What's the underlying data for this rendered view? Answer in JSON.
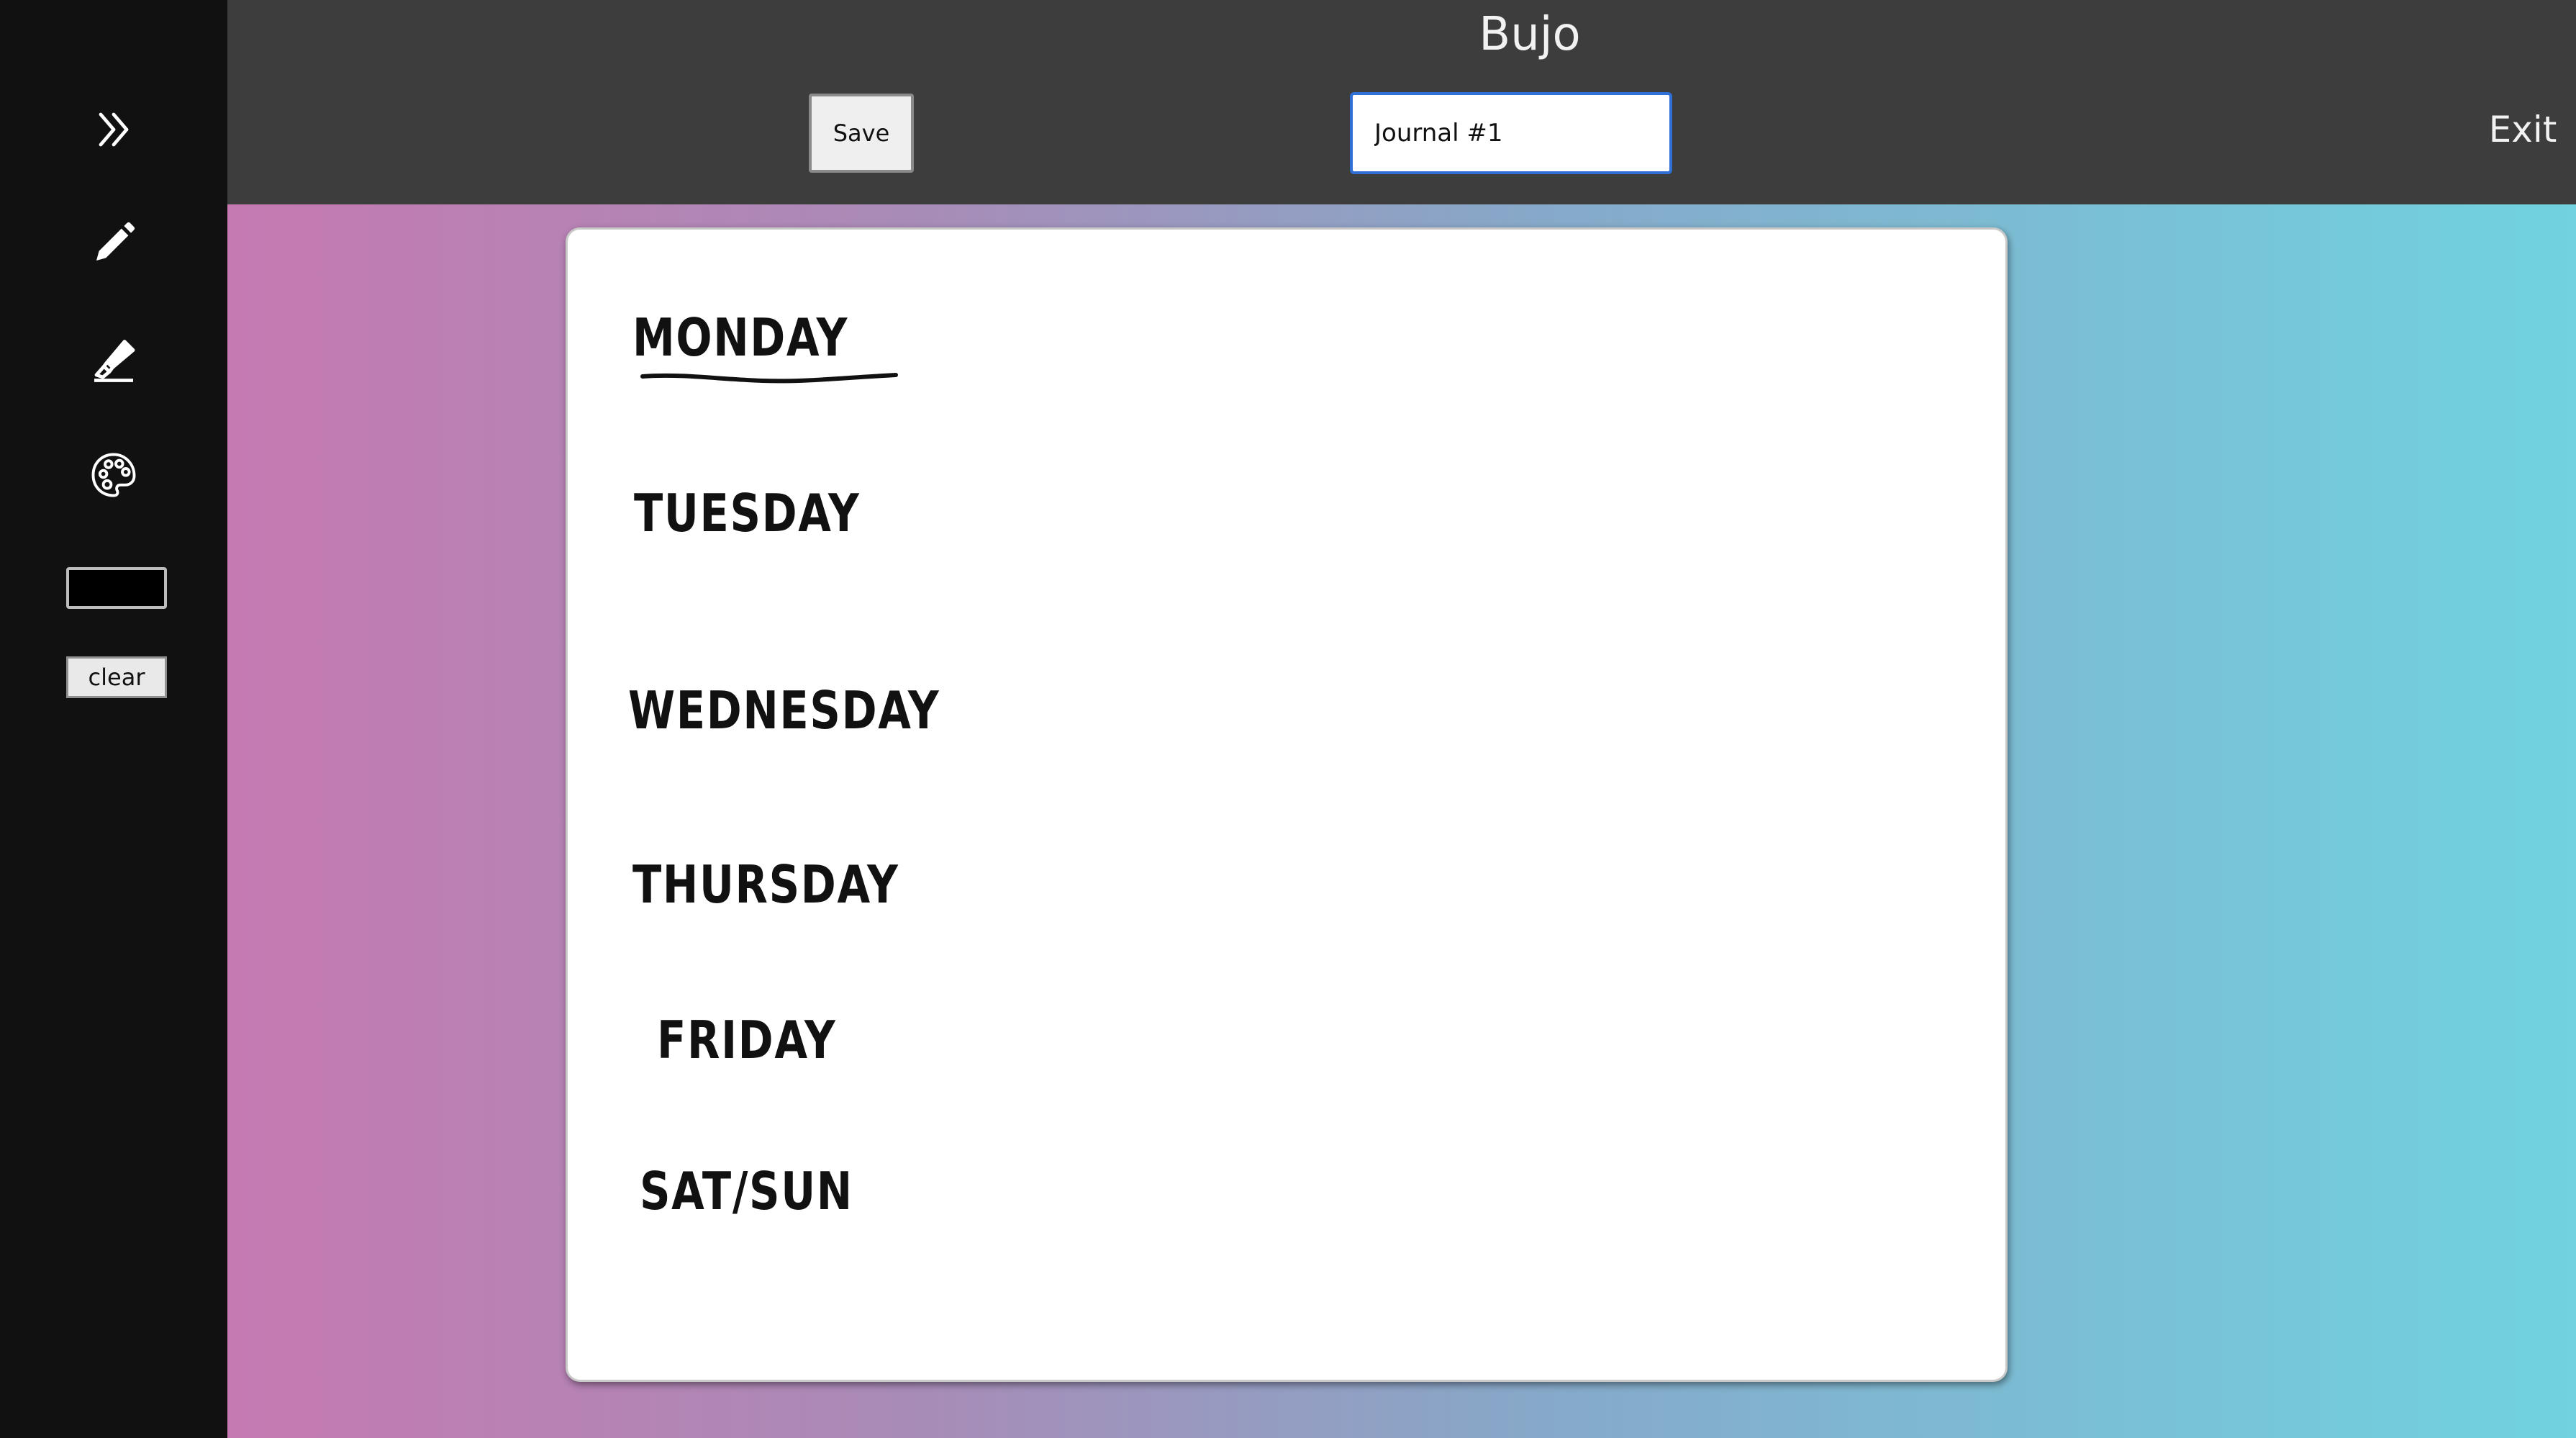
{
  "header": {
    "title": "Bujo",
    "save_label": "Save",
    "journal_name": "Journal #1",
    "exit_label": "Exit"
  },
  "sidebar": {
    "items": [
      {
        "icon": "chevrons-right-icon"
      },
      {
        "icon": "pencil-icon"
      },
      {
        "icon": "highlighter-icon"
      },
      {
        "icon": "palette-icon"
      }
    ],
    "color_swatch": "#000000",
    "clear_label": "clear"
  },
  "page": {
    "days": [
      "MONDAY",
      "TUESDAY",
      "WEDNESDAY",
      "THURSDAY",
      "FRIDAY",
      "SAT/SUN"
    ]
  },
  "colors": {
    "sidebar_bg": "#111111",
    "header_bg": "#3d3d3d",
    "input_border": "#2f6fd6",
    "gradient_start": "#cf74b0",
    "gradient_end": "#70d3de"
  }
}
